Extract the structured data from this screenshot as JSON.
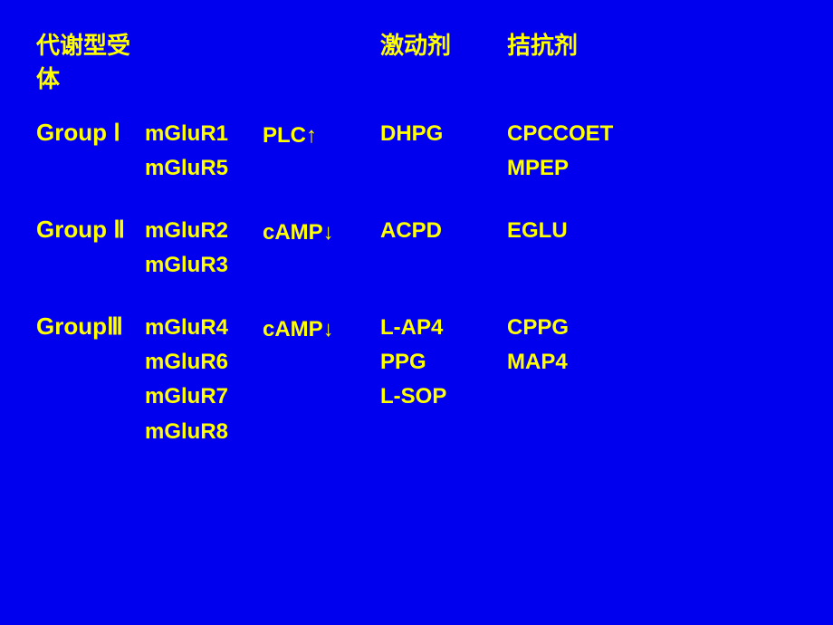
{
  "slide": {
    "background_color": "#0000ee",
    "header": {
      "col1_label": "代谢型受体",
      "col2_label": "激动剂",
      "col3_label": "拮抗剂"
    },
    "groups": [
      {
        "id": "group1",
        "label": "Group Ⅰ",
        "receptors": [
          "mGluR1",
          "mGluR5"
        ],
        "signaling": "PLC↑",
        "agonists": [
          "DHPG"
        ],
        "antagonists": [
          "CPCCOET",
          "MPEP"
        ]
      },
      {
        "id": "group2",
        "label": "Group Ⅱ",
        "receptors": [
          "mGluR2",
          "mGluR3"
        ],
        "signaling": "cAMP↓",
        "agonists": [
          "ACPD"
        ],
        "antagonists": [
          "EGLU"
        ]
      },
      {
        "id": "group3",
        "label": "GroupⅢ",
        "receptors": [
          "mGluR4",
          "mGluR6",
          "mGluR7",
          "mGluR8"
        ],
        "signaling": "cAMP↓",
        "agonists": [
          "L-AP4",
          "PPG",
          "L-SOP"
        ],
        "antagonists": [
          "CPPG",
          "MAP4"
        ]
      }
    ]
  }
}
